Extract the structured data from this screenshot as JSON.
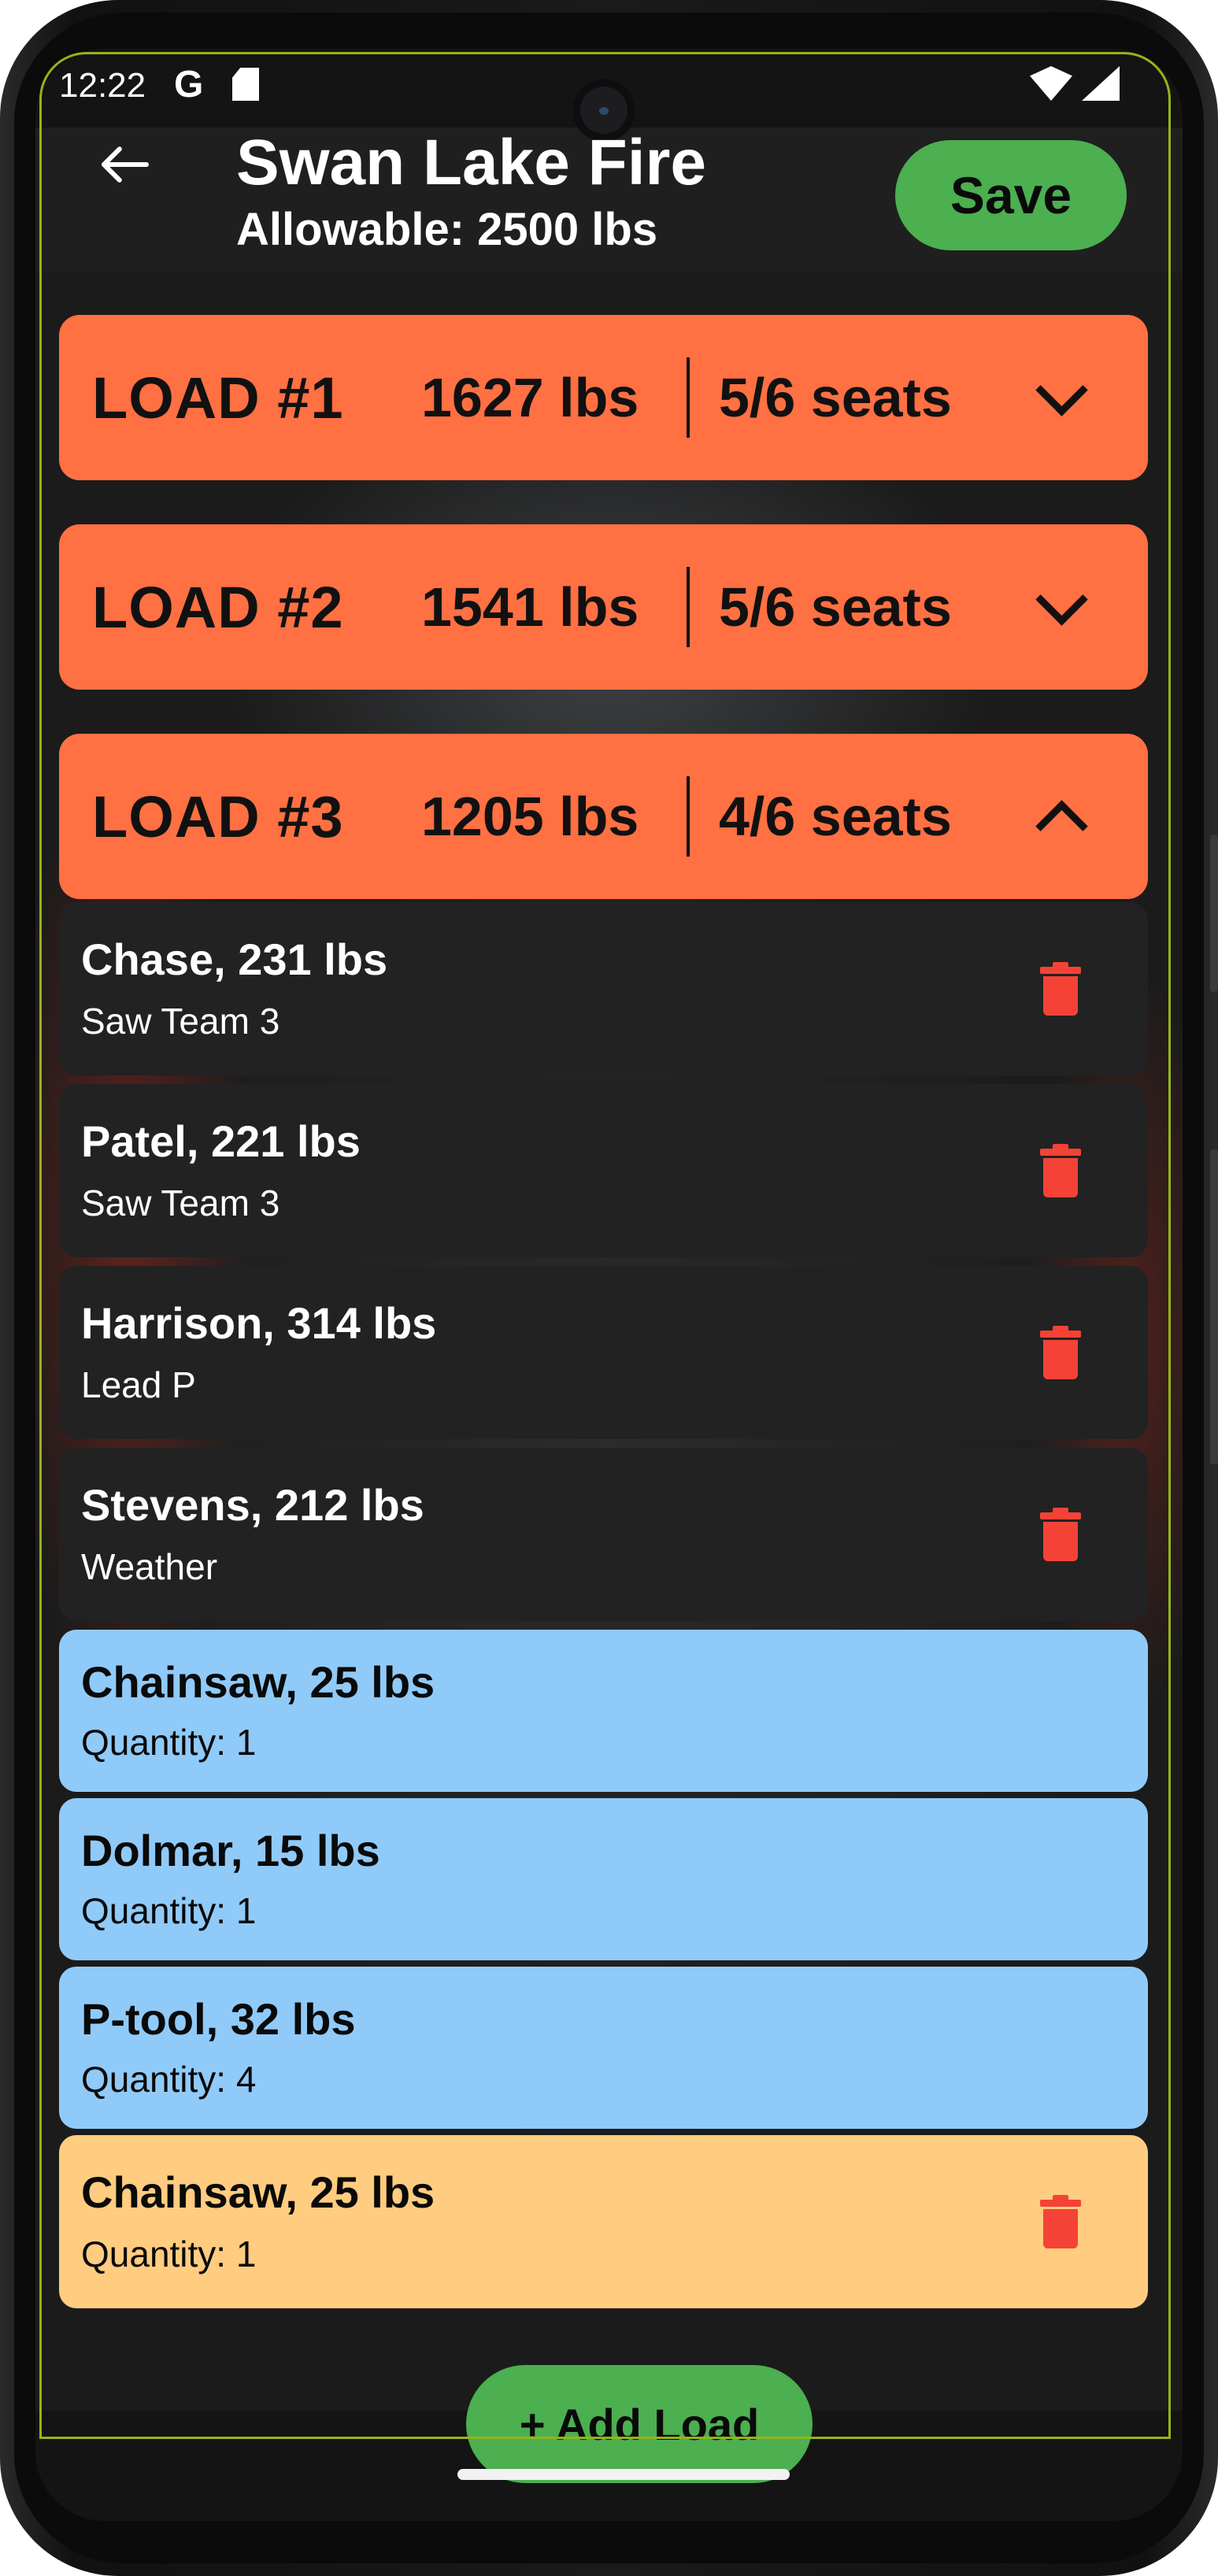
{
  "status_bar": {
    "time": "12:22",
    "app_icon_letter": "G",
    "icons": [
      "google-icon",
      "sd-card-icon",
      "wifi-icon",
      "cell-signal-icon"
    ]
  },
  "app_bar": {
    "title": "Swan Lake Fire",
    "subtitle": "Allowable: 2500 lbs",
    "save_label": "Save",
    "back_icon": "arrow-back-icon"
  },
  "loads": [
    {
      "title": "LOAD #1",
      "weight": "1627 lbs",
      "seats": "5/6 seats",
      "expanded": false
    },
    {
      "title": "LOAD #2",
      "weight": "1541 lbs",
      "seats": "5/6 seats",
      "expanded": false
    },
    {
      "title": "LOAD #3",
      "weight": "1205 lbs",
      "seats": "4/6 seats",
      "expanded": true
    }
  ],
  "load3_items": [
    {
      "type": "person",
      "name": "Chase, 231 lbs",
      "sub": "Saw Team 3",
      "deletable": true
    },
    {
      "type": "person",
      "name": "Patel, 221 lbs",
      "sub": "Saw Team 3",
      "deletable": true
    },
    {
      "type": "person",
      "name": "Harrison, 314 lbs",
      "sub": "Lead P",
      "deletable": true
    },
    {
      "type": "person",
      "name": "Stevens, 212 lbs",
      "sub": "Weather",
      "deletable": true
    },
    {
      "type": "gear",
      "name": "Chainsaw, 25 lbs",
      "sub": "Quantity: 1",
      "deletable": false
    },
    {
      "type": "gear",
      "name": "Dolmar, 15 lbs",
      "sub": "Quantity: 1",
      "deletable": false
    },
    {
      "type": "gear",
      "name": "P-tool, 32 lbs",
      "sub": "Quantity: 4",
      "deletable": false
    },
    {
      "type": "custom",
      "name": "Chainsaw, 25 lbs",
      "sub": "Quantity: 1",
      "deletable": true
    }
  ],
  "add_load_label": "+ Add Load",
  "colors": {
    "load_header": "#ff7043",
    "person_item": "#222222",
    "gear_item": "#90caf9",
    "custom_item": "#ffcc80",
    "accent_green": "#4caf50",
    "delete_red": "#f44336"
  }
}
